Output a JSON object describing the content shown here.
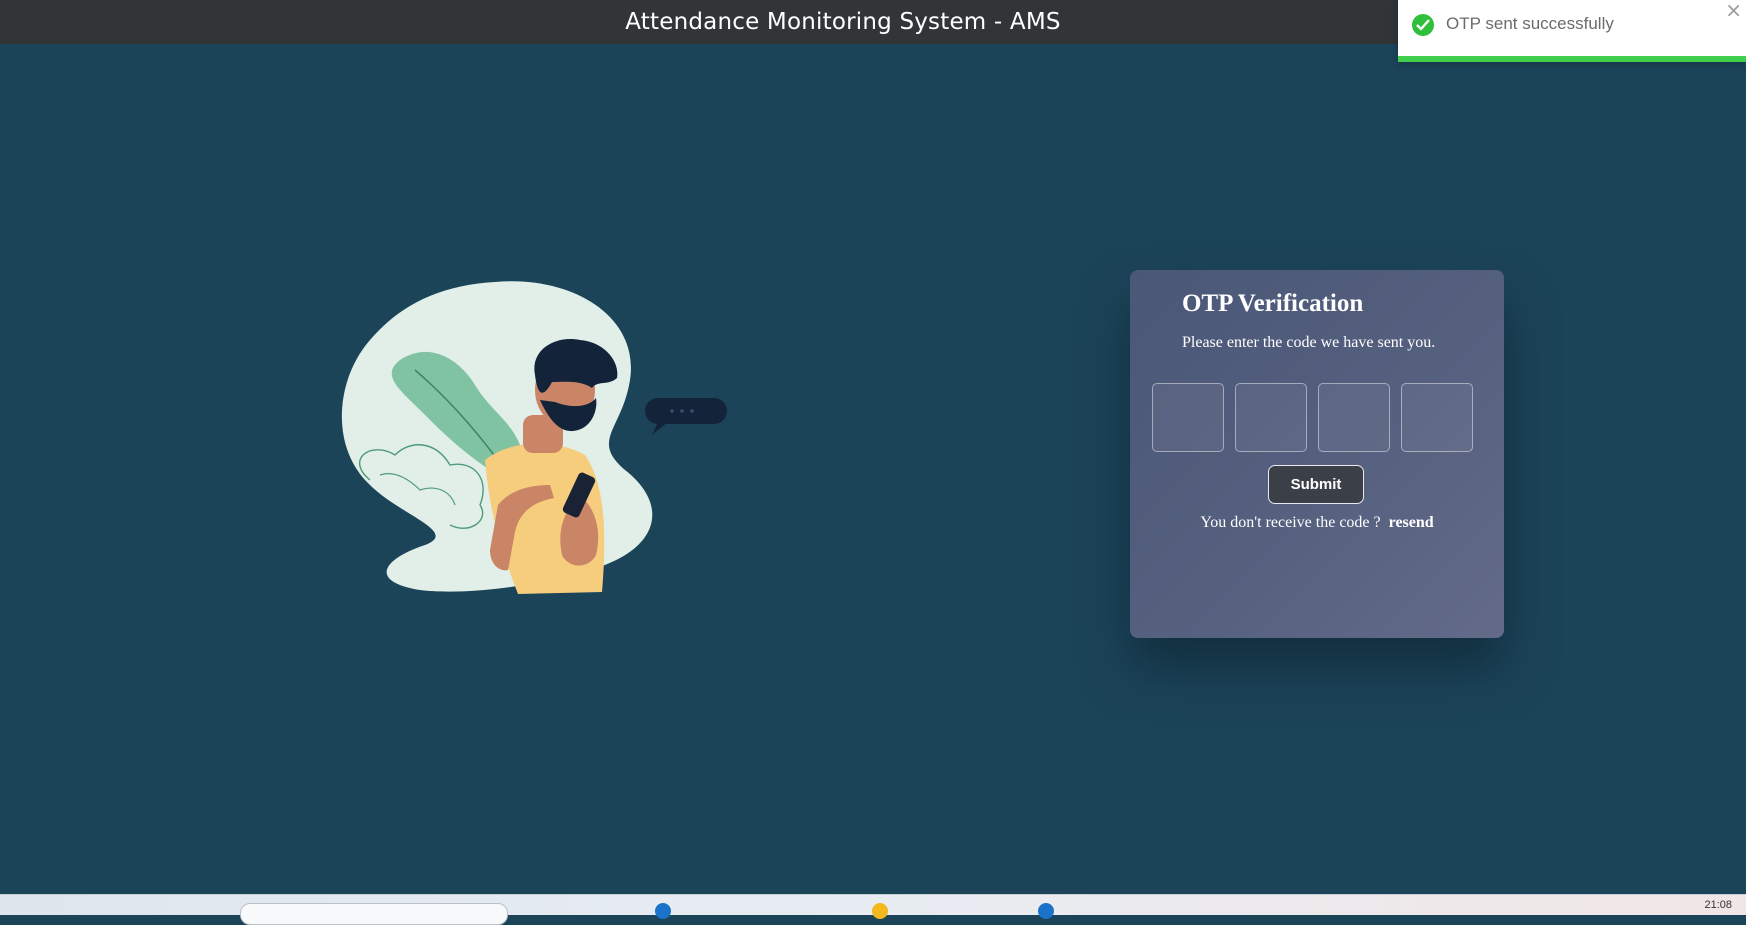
{
  "header": {
    "title": "Attendance Monitoring System - AMS"
  },
  "toast": {
    "message": "OTP sent successfully",
    "close_glyph": "×",
    "icon": "check-circle-icon",
    "color": "#2fbf3a"
  },
  "otp_card": {
    "title": "OTP Verification",
    "subtitle": "Please enter the code we have sent you.",
    "digits": [
      "",
      "",
      "",
      ""
    ],
    "submit_label": "Submit",
    "resend_prompt": "You don't receive the code ?",
    "resend_label": "resend"
  },
  "colors": {
    "background": "#1c4459",
    "header": "#313538",
    "card": "#56607f"
  },
  "taskbar": {
    "clock": "21:08"
  }
}
